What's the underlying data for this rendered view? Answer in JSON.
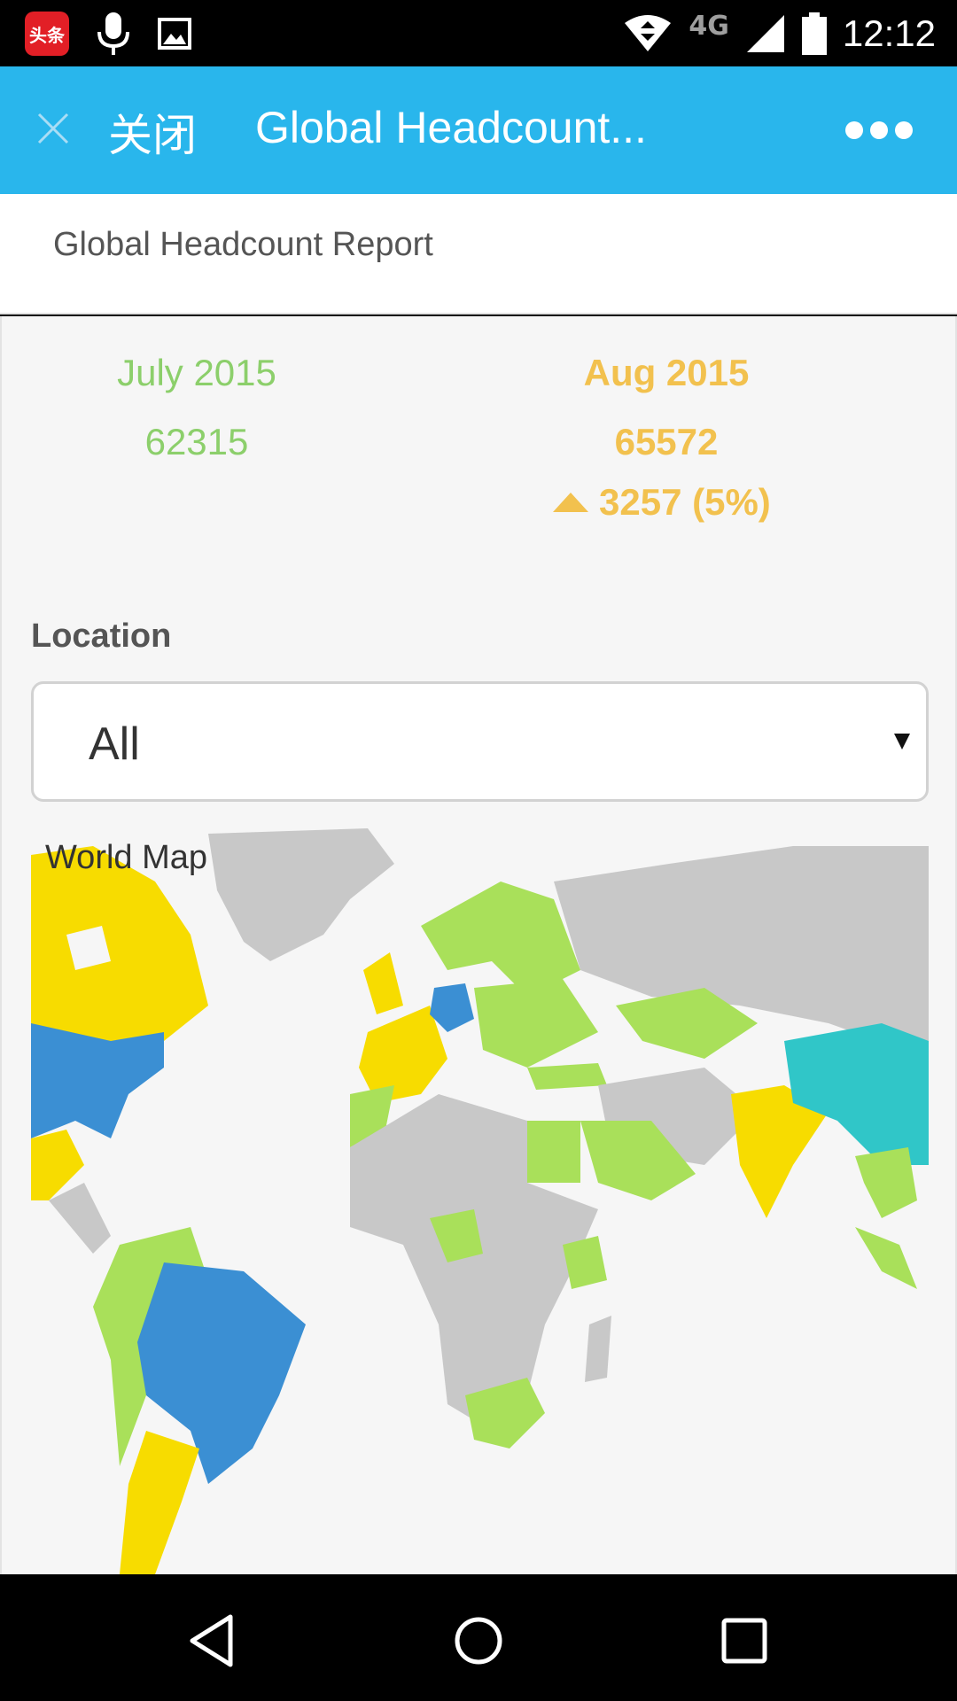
{
  "status_bar": {
    "app_badge": "头条",
    "network": "4G",
    "time": "12:12"
  },
  "header": {
    "close_label": "关闭",
    "title": "Global Headcount..."
  },
  "report": {
    "title": "Global Headcount Report"
  },
  "periods": {
    "previous": {
      "label": "July 2015",
      "value": "62315"
    },
    "current": {
      "label": "Aug 2015",
      "value": "65572"
    },
    "change": "3257 (5%)"
  },
  "filter": {
    "label": "Location",
    "selected": "All"
  },
  "map": {
    "title": "World Map",
    "colors": {
      "ocean": "#f6f6f6",
      "land_default": "#c8c8c8",
      "tier_light": "#a9e05a",
      "tier_yellow": "#f7dc00",
      "tier_blue": "#3b8fd3",
      "tier_teal": "#30c6c8"
    }
  },
  "accent_colors": {
    "header_bg": "#29b6ec",
    "previous_period": "#8ccf6b",
    "current_period": "#f2c14e"
  },
  "nav": {
    "icons": [
      "back-icon",
      "home-icon",
      "recent-apps-icon"
    ]
  }
}
